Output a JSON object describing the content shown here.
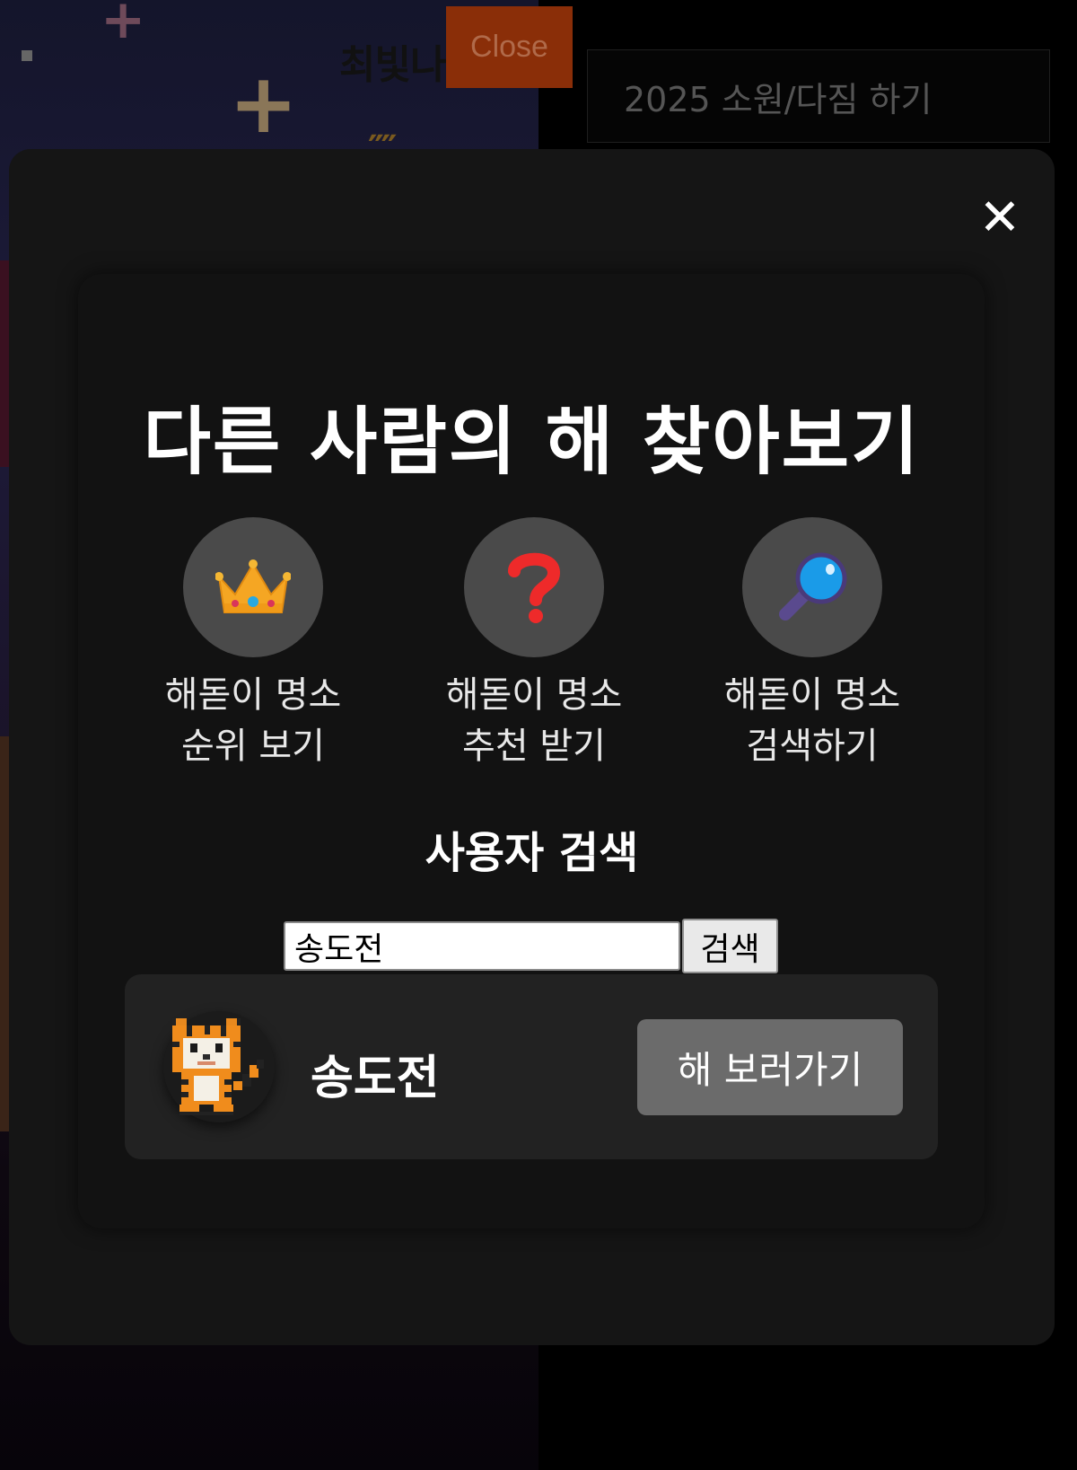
{
  "background": {
    "title": "최빛나",
    "close_label": "Close",
    "wish_button_label": "2025 소원/다짐 하기"
  },
  "modal": {
    "close_symbol": "✕",
    "heading": "다른 사람의 해 찾아보기",
    "features": [
      {
        "icon": "crown-icon",
        "label": "해돋이 명소\n순위 보기"
      },
      {
        "icon": "question-mark-icon",
        "label": "해돋이 명소\n추천 받기"
      },
      {
        "icon": "magnifier-icon",
        "label": "해돋이 명소\n검색하기"
      }
    ],
    "user_search": {
      "title": "사용자 검색",
      "input_value": "송도전",
      "button_label": "검색"
    },
    "results": [
      {
        "avatar": "pixel-tiger-avatar",
        "name": "송도전",
        "action_label": "해 보러가기"
      }
    ]
  },
  "colors": {
    "modal_bg": "#151515",
    "feature_circle": "#4a4a4a",
    "result_card": "#222222",
    "visit_button": "#6b6b6b",
    "bg_close_button": "#8a2e08"
  }
}
